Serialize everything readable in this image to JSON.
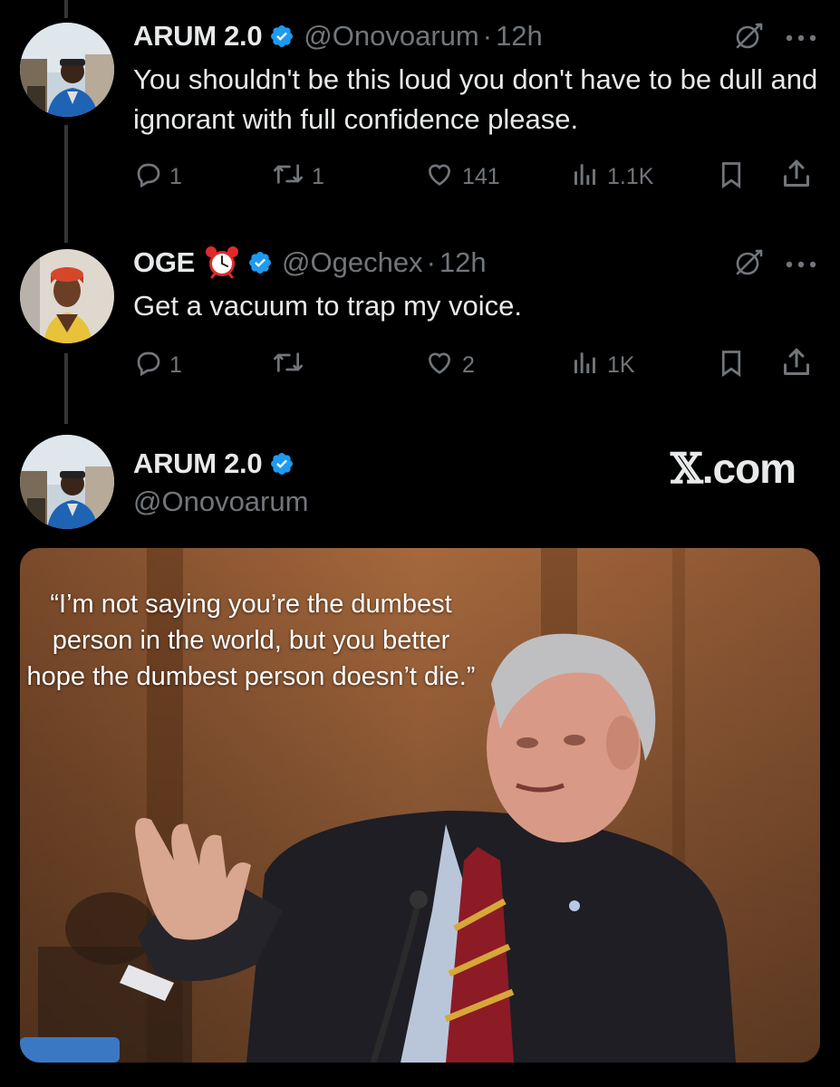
{
  "tweets": [
    {
      "name": "ARUM 2.0",
      "handle": "@Onovoarum",
      "dot": "·",
      "time": "12h",
      "text": "You shouldn't be this loud you don't have to be dull and ignorant with full confidence please.",
      "replies": "1",
      "reposts": "1",
      "likes": "141",
      "views": "1.1K"
    },
    {
      "name": "OGE",
      "emoji": "⏰",
      "handle": "@Ogechex",
      "dot": "·",
      "time": "12h",
      "text": "Get a vacuum to trap my voice.",
      "replies": "1",
      "reposts": "",
      "likes": "2",
      "views": "1K"
    }
  ],
  "quoted_post": {
    "name": "ARUM 2.0",
    "handle": "@Onovoarum",
    "watermark_x": "𝕏",
    "watermark_domain": ".com",
    "image_quote": "“I’m not saying you’re the dumbest person in the world, but you better hope the dumbest person doesn’t die.”"
  },
  "colors": {
    "background": "#000000",
    "text": "#e7e9ea",
    "secondary": "#71767b",
    "verified": "#1d9bf0",
    "thread_line": "#333639"
  },
  "icons": [
    "reply-icon",
    "repost-icon",
    "like-icon",
    "views-icon",
    "bookmark-icon",
    "share-icon",
    "grok-icon",
    "more-icon",
    "verified-badge-icon",
    "alarm-clock-emoji"
  ]
}
